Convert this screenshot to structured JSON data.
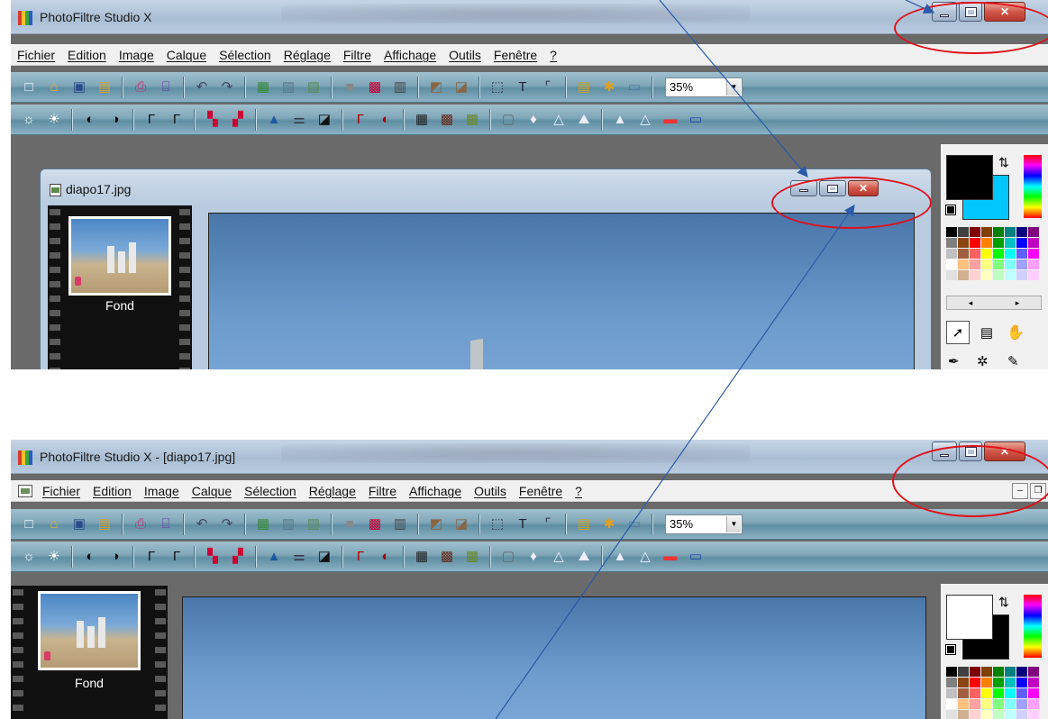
{
  "top": {
    "title": "PhotoFiltre Studio X",
    "menu": [
      "Fichier",
      "Edition",
      "Image",
      "Calque",
      "Sélection",
      "Réglage",
      "Filtre",
      "Affichage",
      "Outils",
      "Fenêtre",
      "?"
    ],
    "zoom": "35%",
    "doc_title": "diapo17.jpg",
    "layer_name": "Fond",
    "fg_color": "#000000",
    "bg_color": "#00c8ff"
  },
  "bottom": {
    "title": "PhotoFiltre Studio X - [diapo17.jpg]",
    "menu": [
      "Fichier",
      "Edition",
      "Image",
      "Calque",
      "Sélection",
      "Réglage",
      "Filtre",
      "Affichage",
      "Outils",
      "Fenêtre",
      "?"
    ],
    "zoom": "35%",
    "layer_name": "Fond",
    "fg_color": "#ffffff",
    "bg_color": "#000000"
  },
  "annotation_color": "#e0101a",
  "arrow_color": "#2a5aa8",
  "icons": {
    "toolbar1": [
      "new-file-icon",
      "open-folder-icon",
      "save-icon",
      "save-as-icon",
      "print-icon",
      "scan-icon",
      "undo-icon",
      "redo-icon",
      "image-size-icon",
      "canvas-size-icon",
      "crop-icon",
      "grayscale-icon",
      "color-palette-icon",
      "color-replace-icon",
      "transform-icon",
      "transform2-icon",
      "selection-icon",
      "text-icon",
      "selection-tool-icon",
      "folder-tree-icon",
      "effects-icon",
      "window-icon"
    ],
    "toolbar2": [
      "brightness-minus-icon",
      "brightness-plus-icon",
      "contrast-minus-icon",
      "contrast-plus-icon",
      "gamma-minus-icon",
      "gamma-plus-icon",
      "saturation-minus-icon",
      "saturation-plus-icon",
      "levels-icon",
      "balance-icon",
      "threshold-icon",
      "auto-levels-icon",
      "auto-contrast-icon",
      "mosaic-icon",
      "pixelize-icon",
      "emboss-icon",
      "blur-icon",
      "drop-icon",
      "sharpen-icon",
      "relief-icon",
      "triangle-icon",
      "triangle2-icon",
      "gradient-icon",
      "monitor-icon"
    ]
  }
}
